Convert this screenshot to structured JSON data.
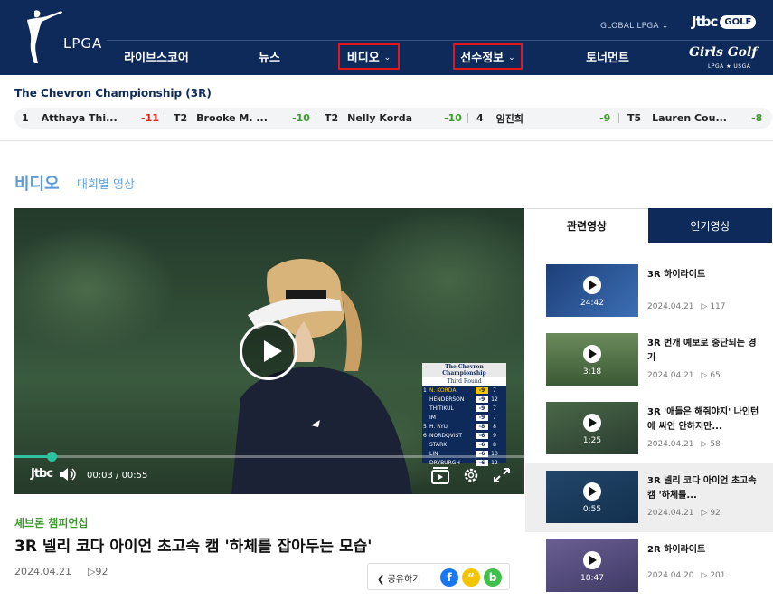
{
  "header": {
    "logo_text": "LPGA",
    "global_link": "GLOBAL LPGA",
    "brand_jtbc": "Jtbc",
    "brand_golf": "GOLF",
    "girls_golf": "Girls Golf",
    "girls_golf_sub": "LPGA ★ USGA",
    "nav": [
      {
        "label": "라이브스코어",
        "dropdown": false
      },
      {
        "label": "뉴스",
        "dropdown": false
      },
      {
        "label": "비디오",
        "dropdown": true
      },
      {
        "label": "선수정보",
        "dropdown": true
      },
      {
        "label": "토너먼트",
        "dropdown": false
      }
    ]
  },
  "leaderboard": {
    "title": "The Chevron Championship (3R)",
    "entries": [
      {
        "pos": "1",
        "name": "Atthaya Thi...",
        "score": "-11",
        "color": "#e3261b"
      },
      {
        "pos": "T2",
        "name": "Brooke M. ...",
        "score": "-10",
        "color": "#3c9a2c"
      },
      {
        "pos": "T2",
        "name": "Nelly Korda",
        "score": "-10",
        "color": "#3c9a2c"
      },
      {
        "pos": "4",
        "name": "임진희",
        "score": "-9",
        "color": "#3c9a2c"
      },
      {
        "pos": "T5",
        "name": "Lauren Cou...",
        "score": "-8",
        "color": "#3c9a2c"
      }
    ]
  },
  "section": {
    "title": "비디오",
    "subtitle": "대회별 영상"
  },
  "player": {
    "current_time": "00:03",
    "duration": "00:55",
    "progress_fraction": 0.055,
    "ctrl_logo": "Jtbc",
    "scoreboard": {
      "header": "The Chevron Championship",
      "round": "Third Round",
      "rows": [
        {
          "pos": "1",
          "name": "N. KORDA",
          "score": "-9",
          "thru": "7",
          "highlight": true
        },
        {
          "pos": "",
          "name": "HENDERSON",
          "score": "-9",
          "thru": "12",
          "highlight": false
        },
        {
          "pos": "",
          "name": "THITIKUL",
          "score": "-9",
          "thru": "7",
          "highlight": false
        },
        {
          "pos": "",
          "name": "IM",
          "score": "-9",
          "thru": "7",
          "highlight": false
        },
        {
          "pos": "5",
          "name": "H. RYU",
          "score": "-8",
          "thru": "8",
          "highlight": false
        },
        {
          "pos": "6",
          "name": "NORDQVIST",
          "score": "-6",
          "thru": "9",
          "highlight": false
        },
        {
          "pos": "",
          "name": "STARK",
          "score": "-6",
          "thru": "8",
          "highlight": false
        },
        {
          "pos": "",
          "name": "LIN",
          "score": "-6",
          "thru": "10",
          "highlight": false
        },
        {
          "pos": "",
          "name": "DRYBURGH",
          "score": "-6",
          "thru": "12",
          "highlight": false
        }
      ],
      "cap_text": "Callaway"
    }
  },
  "video": {
    "category": "셰브론 챔피언십",
    "title": "3R 넬리 코다 아이언 초고속 캠 '하체를 잡아두는 모습'",
    "date": "2024.04.21",
    "views": "▷92",
    "share_label": "공유하기"
  },
  "sidebar": {
    "tab_related": "관련영상",
    "tab_popular": "인기영상",
    "items": [
      {
        "title": "3R 하이라이트",
        "date": "2024.04.21",
        "views": "▷ 117",
        "duration": "24:42",
        "active": false,
        "thumb_color": "#2a4e86"
      },
      {
        "title": "3R 번개 예보로 중단되는 경기",
        "date": "2024.04.21",
        "views": "▷ 65",
        "duration": "3:18",
        "active": false,
        "thumb_color": "#4a6e3c"
      },
      {
        "title": "3R '애들은 해줘야지' 나인턴에 싸인 안하지만...",
        "date": "2024.04.21",
        "views": "▷ 58",
        "duration": "1:25",
        "active": false,
        "thumb_color": "#3f5a3a"
      },
      {
        "title": "3R 넬리 코다 아이언 초고속 캠 '하체를...",
        "date": "2024.04.21",
        "views": "▷ 92",
        "duration": "0:55",
        "active": true,
        "thumb_color": "#21415f"
      },
      {
        "title": "2R 하이라이트",
        "date": "2024.04.20",
        "views": "▷ 201",
        "duration": "18:47",
        "active": false,
        "thumb_color": "#5a4f7a"
      }
    ]
  }
}
